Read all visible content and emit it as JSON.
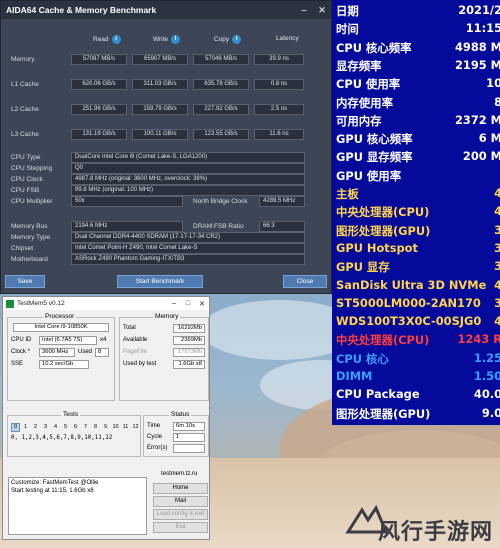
{
  "aida": {
    "title": "AIDA64 Cache & Memory Benchmark",
    "columns": [
      "Read",
      "Write",
      "Copy",
      "Latency"
    ],
    "rows": [
      {
        "label": "Memory",
        "values": [
          "57087 MB/s",
          "65907 MB/s",
          "57046 MB/s",
          "39.9 ns"
        ]
      },
      {
        "label": "L1 Cache",
        "values": [
          "620.06 GB/s",
          "311.03 GB/s",
          "635.78 GB/s",
          "0.8 ns"
        ]
      },
      {
        "label": "L2 Cache",
        "values": [
          "251.96 GB/s",
          "159.79 GB/s",
          "227.92 GB/s",
          "2.5 ns"
        ]
      },
      {
        "label": "L3 Cache",
        "values": [
          "131.19 GB/s",
          "100.11 GB/s",
          "123.55 GB/s",
          "11.6 ns"
        ]
      }
    ],
    "cpu_type_label": "CPU Type",
    "cpu_type": "DualCore Intel Core i9  (Comet Lake-S, LGA1200)",
    "cpu_stepping_label": "CPU Stepping",
    "cpu_stepping": "Q0",
    "cpu_clock_label": "CPU Clock",
    "cpu_clock": "4987.8 MHz  (original: 3600 MHz, overclock: 38%)",
    "cpu_fsb_label": "CPU FSB",
    "cpu_fsb": "99.8 MHz  (original: 100 MHz)",
    "cpu_mult_label": "CPU Multiplier",
    "cpu_mult": "50x",
    "nb_clock_label": "North Bridge Clock",
    "nb_clock": "4289.5 MHz",
    "mem_bus_label": "Memory Bus",
    "mem_bus": "2194.6 MHz",
    "dram_ratio_label": "DRAM:FSB Ratio",
    "dram_ratio": "66:3",
    "mem_type_label": "Memory Type",
    "mem_type": "Dual Channel DDR4-4400 SDRAM  (17-17-17-34 CR2)",
    "chipset_label": "Chipset",
    "chipset": "Intel Comet Point-H Z490, Intel Comet Lake-S",
    "mobo_label": "Motherboard",
    "mobo": "ASRock Z490 Phantom Gaming-ITX/TB3",
    "bios_label": "BIOS Version",
    "bios": "P1.50",
    "footer": "AIDA64 v6.32.5600 / BenchDLL 4.5.841.8-x64  (c) 1995-2020 FinalWire Ltd.",
    "save_label": "Save",
    "start_label": "Start Benchmark",
    "close_label": "Close"
  },
  "hw": {
    "rows": [
      {
        "label": "日期",
        "value": "2021/2",
        "color": "#ffffff"
      },
      {
        "label": "时间",
        "value": "11:15",
        "color": "#ffffff"
      },
      {
        "label": "CPU 核心频率",
        "value": "4988 M",
        "color": "#ffffff"
      },
      {
        "label": "显存频率",
        "value": "2195 M",
        "color": "#ffffff"
      },
      {
        "label": "CPU 使用率",
        "value": "10",
        "color": "#ffffff"
      },
      {
        "label": "内存使用率",
        "value": "8",
        "color": "#ffffff"
      },
      {
        "label": "可用内存",
        "value": "2372 M",
        "color": "#ffffff"
      },
      {
        "label": "GPU 核心频率",
        "value": "6 M",
        "color": "#ffffff"
      },
      {
        "label": "GPU 显存频率",
        "value": "200 M",
        "color": "#ffffff"
      },
      {
        "label": "GPU 使用率",
        "value": "",
        "color": "#ffffff"
      },
      {
        "label": "主板",
        "value": "4",
        "color": "#ffd44a"
      },
      {
        "label": "中央处理器(CPU)",
        "value": "4",
        "color": "#ffd44a"
      },
      {
        "label": "图形处理器(GPU)",
        "value": "3",
        "color": "#ffd44a"
      },
      {
        "label": "GPU Hotspot",
        "value": "3",
        "color": "#ffd44a"
      },
      {
        "label": "GPU 显存",
        "value": "3",
        "color": "#ffd44a"
      },
      {
        "label": "SanDisk Ultra 3D NVMe",
        "value": "4",
        "color": "#ffd44a"
      },
      {
        "label": "ST5000LM000-2AN170",
        "value": "3",
        "color": "#ffd44a"
      },
      {
        "label": "WDS100T3X0C-00SJG0",
        "value": "4",
        "color": "#ffd44a"
      },
      {
        "label": "中央处理器(CPU)",
        "value": "1243 R",
        "color": "#ff3b3b"
      },
      {
        "label": "CPU 核心",
        "value": "1.25",
        "color": "#3aa0ff"
      },
      {
        "label": "DIMM",
        "value": "1.50",
        "color": "#3aa0ff"
      },
      {
        "label": "CPU Package",
        "value": "40.0",
        "color": "#ffffff"
      },
      {
        "label": "图形处理器(GPU)",
        "value": "9.0",
        "color": "#ffffff"
      }
    ]
  },
  "tm": {
    "title": "TestMem5 v0.12",
    "processor_title": "Processor",
    "cpu_name": "Intel Core i9-10850K",
    "cpu_id_label": "CPU ID",
    "cpu_id": "Intel  (6.7A5 7S)",
    "cpu_id_x": "x4",
    "clock_label": "Clock *",
    "clock": "3600 MHz",
    "used_label": "Used",
    "used": "8",
    "sse_label": "SSE",
    "sse": "10.2 sec/Gb",
    "memory_title": "Memory",
    "total_label": "Total",
    "total": "16292Mb",
    "avail_label": "Available",
    "avail": "2369Mb",
    "pagefile_label": "PageFile",
    "pagefile": "17973Mb",
    "usedtest_label": "Used by test",
    "usedtest": "1.6Gb x8",
    "tests_title": "Tests",
    "test_boxes": [
      "0",
      "1",
      "2",
      "3",
      "4",
      "5",
      "6",
      "7",
      "8",
      "9",
      "10",
      "11",
      "12"
    ],
    "tests_seq": "0, 1,2,3,4,5,6,7,8,9,10,11,12",
    "status_title": "Status",
    "time_label": "Time",
    "time": "6m 10s",
    "cycle_label": "Cycle",
    "cycle": "1",
    "errors_label": "Error(s)",
    "errors": "",
    "log_lines": [
      "Customize: FastMemTest @Ollie",
      "Start testing at 11:15, 1.6Gb x8"
    ],
    "site": "testmem.tz.ru",
    "home_label": "Home",
    "mail_label": "Mail",
    "load_label": "Load config & exit",
    "exit_label": "Exit"
  },
  "watermark": "风行手游网"
}
